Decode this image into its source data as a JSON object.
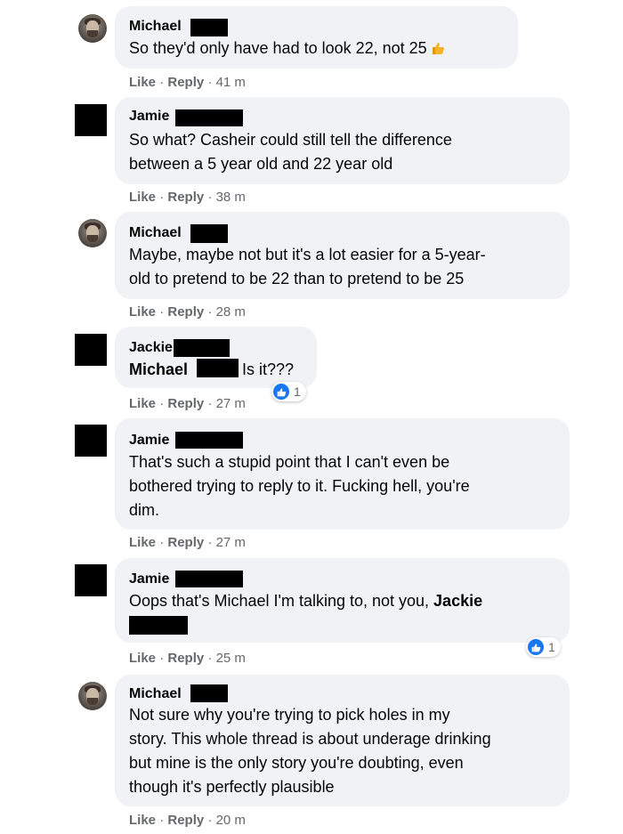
{
  "actions": {
    "like": "Like",
    "reply": "Reply",
    "sep": "·"
  },
  "comments": [
    {
      "name": "Michael",
      "lines": [
        "So they'd only have had to look 22, not 25"
      ],
      "time": "41 m"
    },
    {
      "name": "Jamie",
      "lines": [
        "So what? Casheir could still tell the difference",
        "between a 5 year old and 22 year old"
      ],
      "time": "38 m"
    },
    {
      "name": "Michael",
      "lines": [
        "Maybe, maybe not but it's a lot easier for a 5-year-",
        "old to pretend to be 22 than to pretend to be 25"
      ],
      "time": "28 m"
    },
    {
      "name": "Jackie",
      "mention": "Michael",
      "text": "Is it???",
      "time": "27 m",
      "reactions": "1"
    },
    {
      "name": "Jamie",
      "lines": [
        "That's such a stupid point that I can't even be",
        "bothered trying to reply to it. Fucking hell, you're",
        "dim."
      ],
      "time": "27 m"
    },
    {
      "name": "Jamie",
      "text": "Oops that's Michael I'm talking to, not you, ",
      "mention": "Jackie",
      "time": "25 m",
      "reactions": "1"
    },
    {
      "name": "Michael",
      "lines": [
        "Not sure why you're trying to pick holes in my",
        "story. This whole thread is about underage drinking",
        "but mine is the only story you're doubting, even",
        "though it's perfectly plausible"
      ],
      "time": "20 m"
    }
  ],
  "colors": {
    "bubble": "#f0f2f5",
    "meta": "#65676b",
    "like_blue": "#1877f2",
    "thumb_yellow": "#f7b125"
  }
}
